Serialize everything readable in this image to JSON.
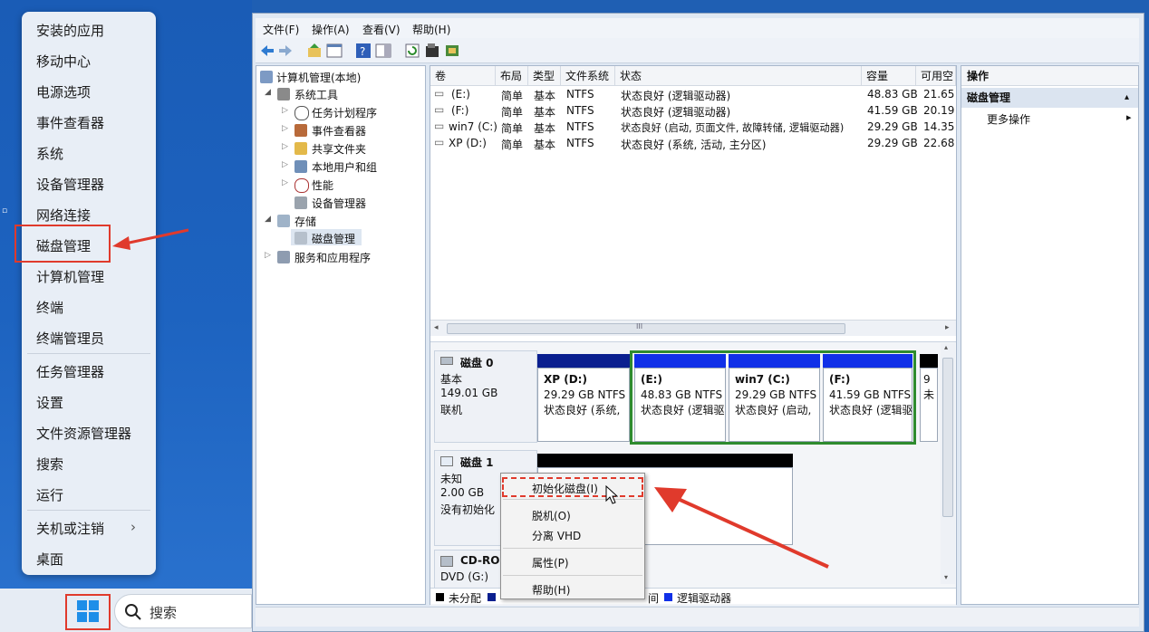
{
  "start_menu": {
    "items": [
      {
        "label": "安装的应用"
      },
      {
        "label": "移动中心"
      },
      {
        "label": "电源选项"
      },
      {
        "label": "事件查看器"
      },
      {
        "label": "系统"
      },
      {
        "label": "设备管理器"
      },
      {
        "label": "网络连接"
      },
      {
        "label": "磁盘管理"
      },
      {
        "label": "计算机管理"
      },
      {
        "label": "终端"
      },
      {
        "label": "终端管理员"
      },
      {
        "label": "任务管理器"
      },
      {
        "label": "设置"
      },
      {
        "label": "文件资源管理器"
      },
      {
        "label": "搜索"
      },
      {
        "label": "运行"
      },
      {
        "label": "关机或注销"
      },
      {
        "label": "桌面"
      }
    ],
    "submenu_arrow": "›"
  },
  "taskbar": {
    "search_placeholder": "搜索"
  },
  "window": {
    "menu": [
      "文件(F)",
      "操作(A)",
      "查看(V)",
      "帮助(H)"
    ]
  },
  "tree": {
    "root": "计算机管理(本地)",
    "system_tools": "系统工具",
    "task_scheduler": "任务计划程序",
    "event_viewer": "事件查看器",
    "shared_folders": "共享文件夹",
    "local_users": "本地用户和组",
    "performance": "性能",
    "device_manager": "设备管理器",
    "storage": "存储",
    "disk_management": "磁盘管理",
    "services": "服务和应用程序"
  },
  "volume_table": {
    "headers": [
      "卷",
      "布局",
      "类型",
      "文件系统",
      "状态",
      "容量",
      "可用空"
    ],
    "rows": [
      [
        "(E:)",
        "简单",
        "基本",
        "NTFS",
        "状态良好 (逻辑驱动器)",
        "48.83 GB",
        "21.65"
      ],
      [
        "(F:)",
        "简单",
        "基本",
        "NTFS",
        "状态良好 (逻辑驱动器)",
        "41.59 GB",
        "20.19"
      ],
      [
        "win7 (C:)",
        "简单",
        "基本",
        "NTFS",
        "状态良好 (启动, 页面文件, 故障转储, 逻辑驱动器)",
        "29.29 GB",
        "14.35"
      ],
      [
        "XP (D:)",
        "简单",
        "基本",
        "NTFS",
        "状态良好 (系统, 活动, 主分区)",
        "29.29 GB",
        "22.68"
      ]
    ],
    "scroll_grip": "III"
  },
  "disk0": {
    "name": "磁盘 0",
    "type": "基本",
    "size": "149.01 GB",
    "status": "联机",
    "partitions": [
      {
        "title": "XP  (D:)",
        "size": "29.29 GB NTFS",
        "status": "状态良好 (系统,"
      },
      {
        "title": "(E:)",
        "size": "48.83 GB NTFS",
        "status": "状态良好 (逻辑驱"
      },
      {
        "title": "win7  (C:)",
        "size": "29.29 GB NTFS",
        "status": "状态良好 (启动,"
      },
      {
        "title": "(F:)",
        "size": "41.59 GB NTFS",
        "status": "状态良好 (逻辑驱"
      },
      {
        "title": "",
        "size": "9",
        "status": "未"
      }
    ]
  },
  "disk1": {
    "name": "磁盘 1",
    "type": "未知",
    "size": "2.00 GB",
    "status": "没有初始化"
  },
  "cdrom": {
    "name": "CD-ROI",
    "drive": "DVD (G:)"
  },
  "legend": {
    "unallocated": "未分配",
    "partial": "间",
    "logical": "逻辑驱动器"
  },
  "context_menu": {
    "items": [
      "初始化磁盘(I)",
      "脱机(O)",
      "分离 VHD",
      "属性(P)",
      "帮助(H)"
    ]
  },
  "actions": {
    "header": "操作",
    "section": "磁盘管理",
    "more": "更多操作",
    "more_arrow": "▸",
    "collapse_arrow": "▴"
  },
  "colors": {
    "highlight_red": "#e03a2c",
    "primary_partition_bar": "#0a1f8f",
    "logical_partition_bar": "#1030e8",
    "extended_border": "#2e8b2e",
    "unallocated_bar": "#000000"
  }
}
